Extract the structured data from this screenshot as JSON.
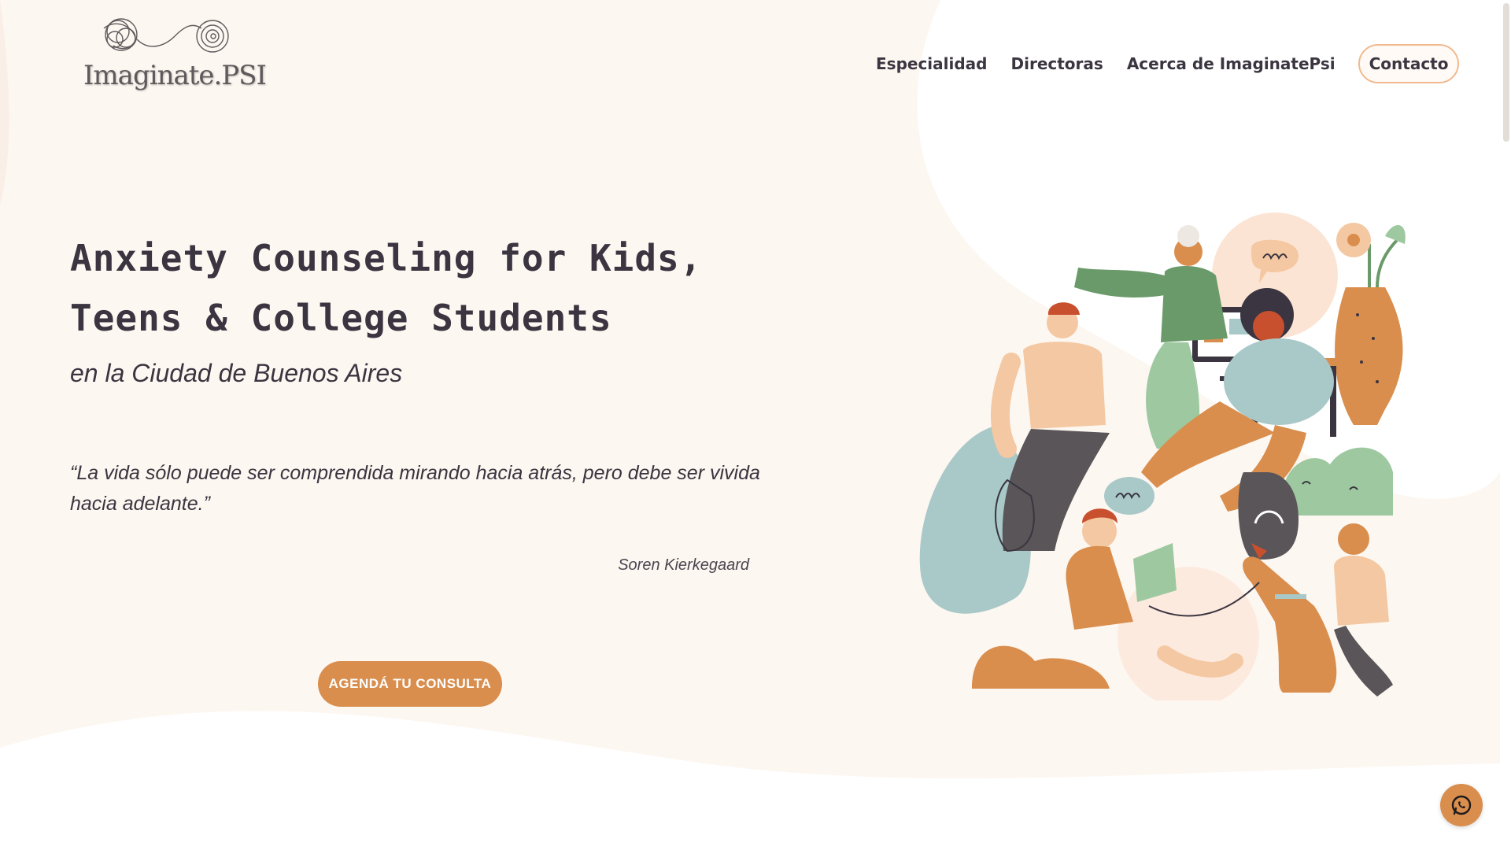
{
  "brand": {
    "logo_text": "Imaginate.PSI"
  },
  "nav": {
    "items": [
      {
        "label": "Especialidad"
      },
      {
        "label": "Directoras"
      },
      {
        "label": "Acerca de ImaginatePsi"
      }
    ],
    "contact_label": "Contacto"
  },
  "hero": {
    "title_line1": "Anxiety Counseling for Kids,",
    "title_line2": "Teens & College Students",
    "subtitle": "en la Ciudad de Buenos Aires",
    "quote": "“La vida sólo puede ser comprendida mirando hacia atrás, pero debe ser vivida hacia adelante.”",
    "quote_author": "Soren Kierkegaard",
    "cta_label": "AGENDÁ TU CONSULTA"
  },
  "colors": {
    "accent": "#d98e4e",
    "text": "#3a3540",
    "background": "#fdf7f1",
    "contact_border": "#f0b98f"
  },
  "icons": {
    "floating_button": "whatsapp-icon"
  }
}
